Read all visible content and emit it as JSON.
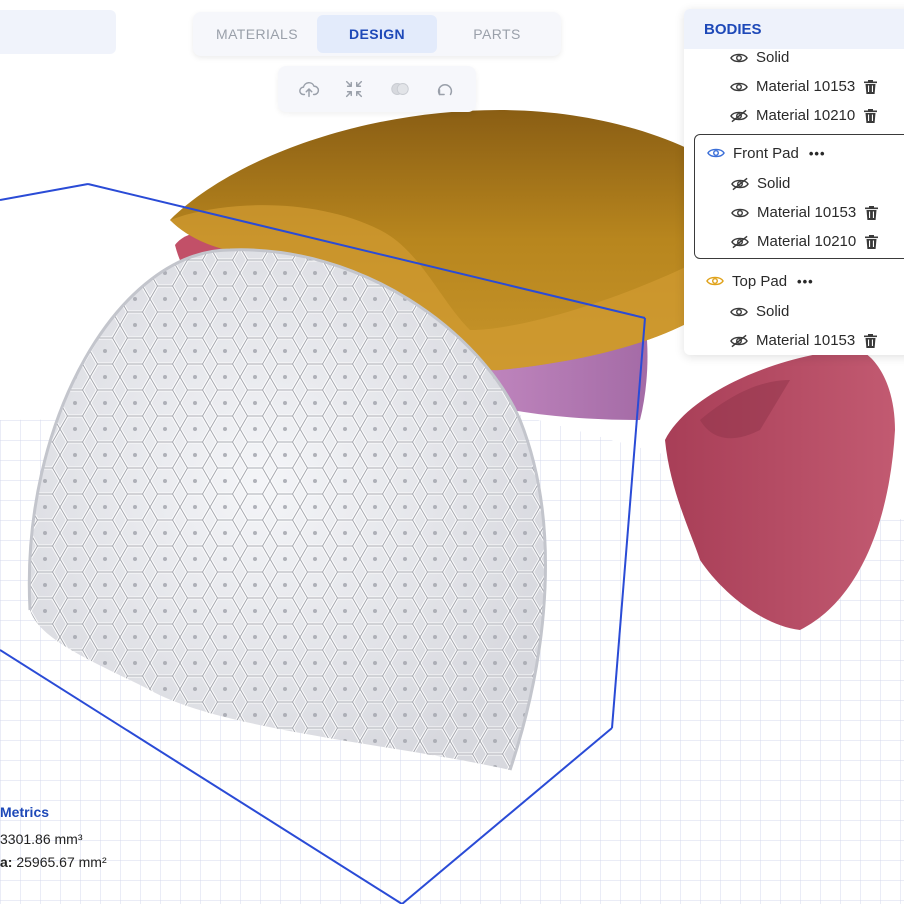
{
  "colors": {
    "accent": "#1e49b8",
    "bounding_box": "#2a4bd6",
    "lattice": "#e6e7ec",
    "top_pad": "#b8861e",
    "purple_body": "#c287bf",
    "red_body": "#b34a62",
    "grid": "#c9cfe8"
  },
  "tabs": [
    {
      "label": "MATERIALS",
      "active": false
    },
    {
      "label": "DESIGN",
      "active": true
    },
    {
      "label": "PARTS",
      "active": false
    }
  ],
  "toolbar": [
    {
      "icon": "cloud-upload-icon"
    },
    {
      "icon": "shrink-icon"
    },
    {
      "icon": "merge-icon"
    },
    {
      "icon": "reset-icon"
    }
  ],
  "bodies": {
    "title": "BODIES",
    "top_rows": [
      {
        "label": "Solid",
        "visible": true,
        "deletable": false
      },
      {
        "label": "Material 10153",
        "visible": true,
        "deletable": true
      },
      {
        "label": "Material 10210",
        "visible": false,
        "deletable": true
      }
    ],
    "groups": [
      {
        "name": "Front Pad",
        "more": "•••",
        "color": "#3b6fd8",
        "selected": true,
        "items": [
          {
            "label": "Solid",
            "visible": false,
            "deletable": false
          },
          {
            "label": "Material 10153",
            "visible": true,
            "deletable": true
          },
          {
            "label": "Material 10210",
            "visible": false,
            "deletable": true
          }
        ]
      },
      {
        "name": "Top Pad",
        "more": "•••",
        "color": "#e0a21a",
        "selected": false,
        "items": [
          {
            "label": "Solid",
            "visible": true,
            "deletable": false
          },
          {
            "label": "Material 10153",
            "visible": false,
            "deletable": true
          }
        ]
      }
    ]
  },
  "metrics": {
    "title": "Metrics",
    "volume_text": "3301.86 mm³",
    "area_label": "a:",
    "area_text": "25965.67 mm²"
  }
}
